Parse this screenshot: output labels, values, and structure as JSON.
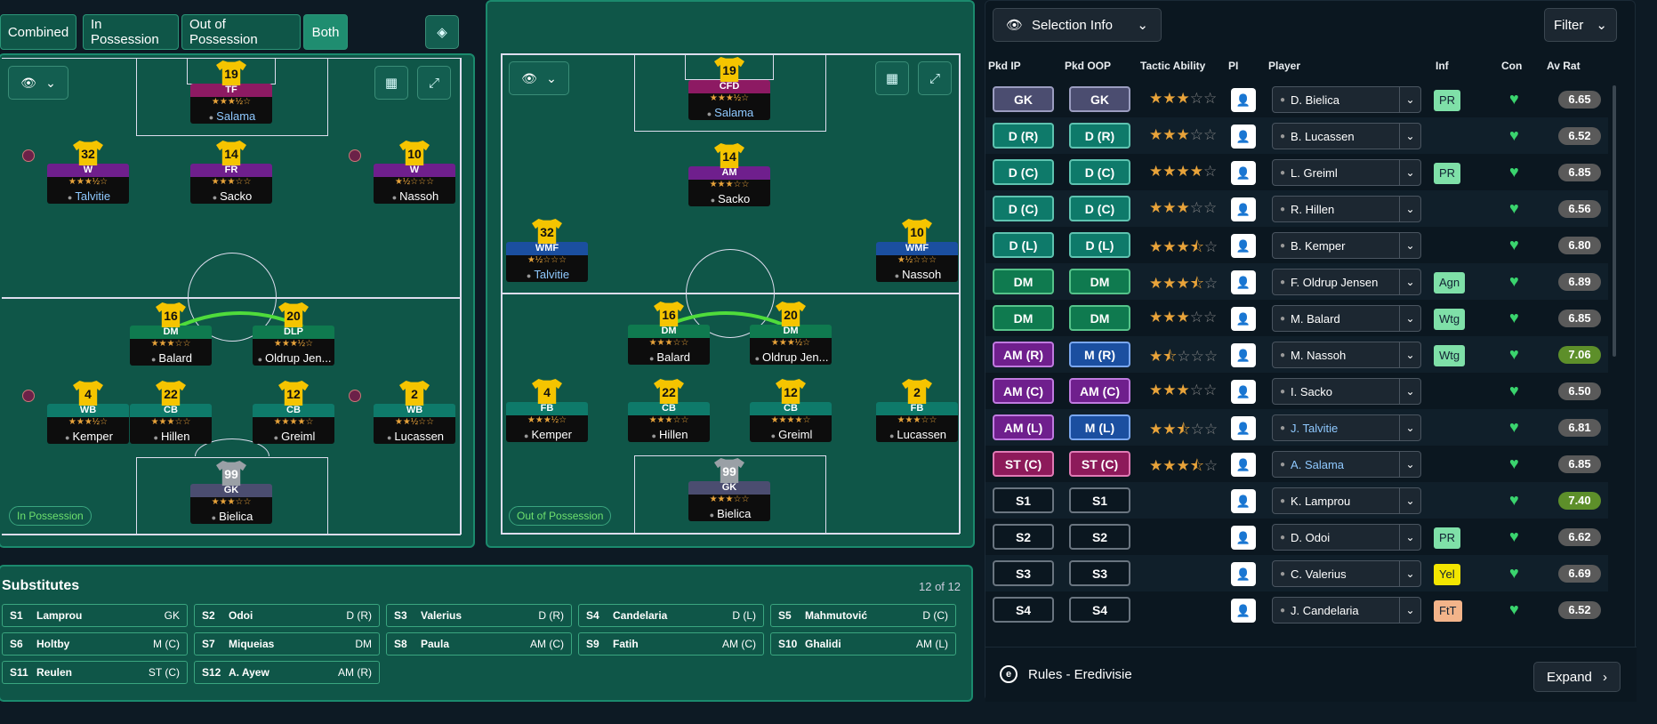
{
  "tabs": [
    {
      "label": "Combined"
    },
    {
      "label": "In Possession"
    },
    {
      "label": "Out of Possession"
    },
    {
      "label": "Both"
    }
  ],
  "ip_label": "In Possession",
  "oop_label": "Out of Possession",
  "ip_players": [
    {
      "num": "19",
      "role": "TF",
      "stars": "★★★½☆",
      "name": "Salama",
      "link": true
    },
    {
      "num": "32",
      "role": "W",
      "stars": "★★★½☆",
      "name": "Talvitie",
      "link": true
    },
    {
      "num": "14",
      "role": "FR",
      "stars": "★★★☆☆",
      "name": "Sacko",
      "link": false
    },
    {
      "num": "10",
      "role": "W",
      "stars": "★½☆☆☆",
      "name": "Nassoh",
      "link": false
    },
    {
      "num": "16",
      "role": "DM",
      "stars": "★★★☆☆",
      "name": "Balard",
      "link": false
    },
    {
      "num": "20",
      "role": "DLP",
      "stars": "★★★½☆",
      "name": "Oldrup Jen...",
      "link": false
    },
    {
      "num": "4",
      "role": "WB",
      "stars": "★★★½☆",
      "name": "Kemper",
      "link": false
    },
    {
      "num": "22",
      "role": "CB",
      "stars": "★★★☆☆",
      "name": "Hillen",
      "link": false
    },
    {
      "num": "12",
      "role": "CB",
      "stars": "★★★★☆",
      "name": "Greiml",
      "link": false
    },
    {
      "num": "2",
      "role": "WB",
      "stars": "★★½☆☆",
      "name": "Lucassen",
      "link": false
    },
    {
      "num": "99",
      "role": "GK",
      "stars": "★★★☆☆",
      "name": "Bielica",
      "link": false
    }
  ],
  "oop_players": [
    {
      "num": "19",
      "role": "CFD",
      "stars": "★★★½☆",
      "name": "Salama",
      "link": true
    },
    {
      "num": "14",
      "role": "AM",
      "stars": "★★★☆☆",
      "name": "Sacko",
      "link": false
    },
    {
      "num": "32",
      "role": "WMF",
      "stars": "★½☆☆☆",
      "name": "Talvitie",
      "link": true
    },
    {
      "num": "10",
      "role": "WMF",
      "stars": "★½☆☆☆",
      "name": "Nassoh",
      "link": false
    },
    {
      "num": "16",
      "role": "DM",
      "stars": "★★★☆☆",
      "name": "Balard",
      "link": false
    },
    {
      "num": "20",
      "role": "DM",
      "stars": "★★★½☆",
      "name": "Oldrup Jen...",
      "link": false
    },
    {
      "num": "4",
      "role": "FB",
      "stars": "★★★½☆",
      "name": "Kemper",
      "link": false
    },
    {
      "num": "22",
      "role": "CB",
      "stars": "★★★☆☆",
      "name": "Hillen",
      "link": false
    },
    {
      "num": "12",
      "role": "CB",
      "stars": "★★★★☆",
      "name": "Greiml",
      "link": false
    },
    {
      "num": "2",
      "role": "FB",
      "stars": "★★★☆☆",
      "name": "Lucassen",
      "link": false
    },
    {
      "num": "99",
      "role": "GK",
      "stars": "★★★☆☆",
      "name": "Bielica",
      "link": false
    }
  ],
  "subs": {
    "title": "Substitutes",
    "count": "12 of 12",
    "items": [
      {
        "slot": "S1",
        "name": "Lamprou",
        "pos": "GK"
      },
      {
        "slot": "S2",
        "name": "Odoi",
        "pos": "D (R)"
      },
      {
        "slot": "S3",
        "name": "Valerius",
        "pos": "D (R)"
      },
      {
        "slot": "S4",
        "name": "Candelaria",
        "pos": "D (L)"
      },
      {
        "slot": "S5",
        "name": "Mahmutović",
        "pos": "D (C)"
      },
      {
        "slot": "S6",
        "name": "Holtby",
        "pos": "M (C)"
      },
      {
        "slot": "S7",
        "name": "Miqueias",
        "pos": "DM"
      },
      {
        "slot": "S8",
        "name": "Paula",
        "pos": "AM (C)"
      },
      {
        "slot": "S9",
        "name": "Fatih",
        "pos": "AM (C)"
      },
      {
        "slot": "S10",
        "name": "Ghalidi",
        "pos": "AM (L)"
      },
      {
        "slot": "S11",
        "name": "Reulen",
        "pos": "ST (C)"
      },
      {
        "slot": "S12",
        "name": "A. Ayew",
        "pos": "AM (R)"
      }
    ]
  },
  "right": {
    "selection_label": "Selection Info",
    "filter_label": "Filter",
    "headers": {
      "ip": "Pkd IP",
      "oop": "Pkd OOP",
      "ability": "Tactic Ability",
      "pi": "PI",
      "player": "Player",
      "inf": "Inf",
      "con": "Con",
      "rat": "Av Rat"
    },
    "rows": [
      {
        "ip": "GK",
        "oop": "GK",
        "ab": 3,
        "player": "D. Bielica",
        "inf": "PR",
        "rat": "6.65"
      },
      {
        "ip": "D (R)",
        "oop": "D (R)",
        "ab": 3,
        "player": "B. Lucassen",
        "inf": "",
        "rat": "6.52"
      },
      {
        "ip": "D (C)",
        "oop": "D (C)",
        "ab": 4,
        "player": "L. Greiml",
        "inf": "PR",
        "rat": "6.85"
      },
      {
        "ip": "D (C)",
        "oop": "D (C)",
        "ab": 3,
        "player": "R. Hillen",
        "inf": "",
        "rat": "6.56"
      },
      {
        "ip": "D (L)",
        "oop": "D (L)",
        "ab": 3.5,
        "player": "B. Kemper",
        "inf": "",
        "rat": "6.80"
      },
      {
        "ip": "DM",
        "oop": "DM",
        "ab": 3.5,
        "player": "F. Oldrup Jensen",
        "inf": "Agn",
        "rat": "6.89"
      },
      {
        "ip": "DM",
        "oop": "DM",
        "ab": 3,
        "player": "M. Balard",
        "inf": "Wtg",
        "rat": "6.85"
      },
      {
        "ip": "AM (R)",
        "oop": "M (R)",
        "ab": 1.5,
        "player": "M. Nassoh",
        "inf": "Wtg",
        "rat": "7.06"
      },
      {
        "ip": "AM (C)",
        "oop": "AM (C)",
        "ab": 3,
        "player": "I. Sacko",
        "inf": "",
        "rat": "6.50"
      },
      {
        "ip": "AM (L)",
        "oop": "M (L)",
        "ab": 2.5,
        "player": "J. Talvitie",
        "inf": "",
        "rat": "6.81"
      },
      {
        "ip": "ST (C)",
        "oop": "ST (C)",
        "ab": 3.5,
        "player": "A. Salama",
        "inf": "",
        "rat": "6.85"
      },
      {
        "ip": "S1",
        "oop": "S1",
        "ab": 0,
        "player": "K. Lamprou",
        "inf": "",
        "rat": "7.40"
      },
      {
        "ip": "S2",
        "oop": "S2",
        "ab": 0,
        "player": "D. Odoi",
        "inf": "PR",
        "rat": "6.62"
      },
      {
        "ip": "S3",
        "oop": "S3",
        "ab": 0,
        "player": "C. Valerius",
        "inf": "Yel",
        "rat": "6.69"
      },
      {
        "ip": "S4",
        "oop": "S4",
        "ab": 0,
        "player": "J. Candelaria",
        "inf": "FtT",
        "rat": "6.52"
      }
    ],
    "rules_label": "Rules - Eredivisie",
    "expand_label": "Expand"
  },
  "colors": {
    "accent": "#1f8d70",
    "rating_green": "#5d8f2a",
    "heart": "#3ad46e"
  }
}
